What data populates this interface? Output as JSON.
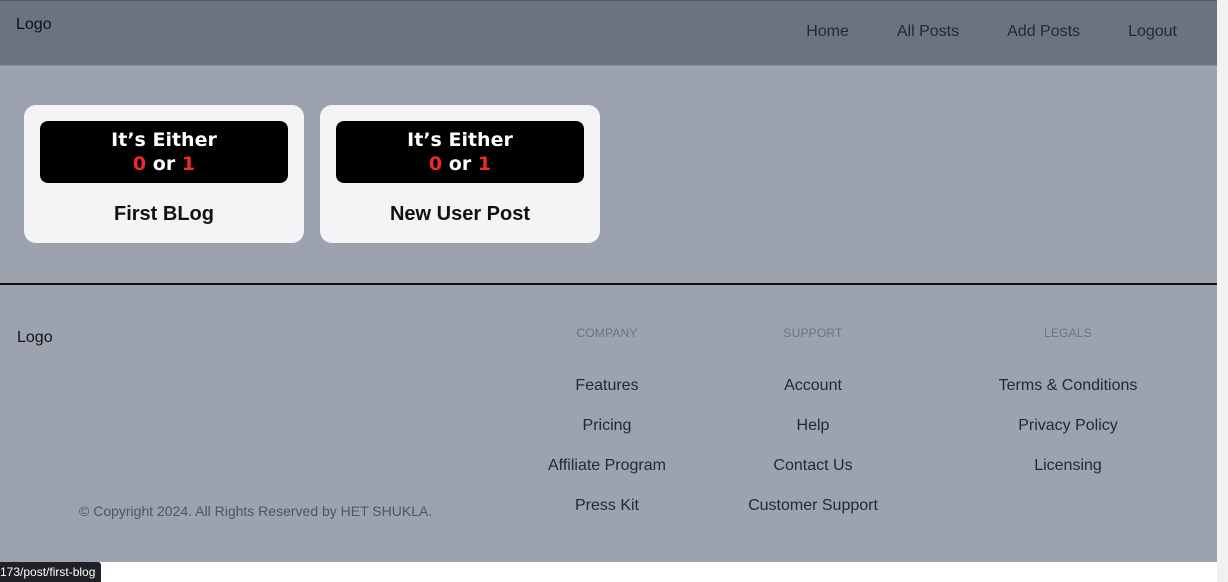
{
  "header": {
    "logo": "Logo",
    "nav": [
      "Home",
      "All Posts",
      "Add Posts",
      "Logout"
    ]
  },
  "posts": [
    {
      "thumb_line1": "It’s Either",
      "thumb_zero": "0",
      "thumb_or": "or",
      "thumb_one": "1",
      "title": "First BLog"
    },
    {
      "thumb_line1": "It’s Either",
      "thumb_zero": "0",
      "thumb_or": "or",
      "thumb_one": "1",
      "title": "New User Post"
    }
  ],
  "footer": {
    "logo": "Logo",
    "copyright": "© Copyright 2024. All Rights Reserved by HET SHUKLA.",
    "company": {
      "heading": "COMPANY",
      "links": [
        "Features",
        "Pricing",
        "Affiliate Program",
        "Press Kit"
      ]
    },
    "support": {
      "heading": "SUPPORT",
      "links": [
        "Account",
        "Help",
        "Contact Us",
        "Customer Support"
      ]
    },
    "legals": {
      "heading": "LEGALS",
      "links": [
        "Terms & Conditions",
        "Privacy Policy",
        "Licensing"
      ]
    }
  },
  "status_bar": {
    "url": "173/post/first-blog"
  },
  "colors": {
    "header_bg": "#6b7280",
    "page_bg": "#9ca3af",
    "card_bg": "#f3f4f6",
    "accent_red": "#ef2b2b"
  }
}
